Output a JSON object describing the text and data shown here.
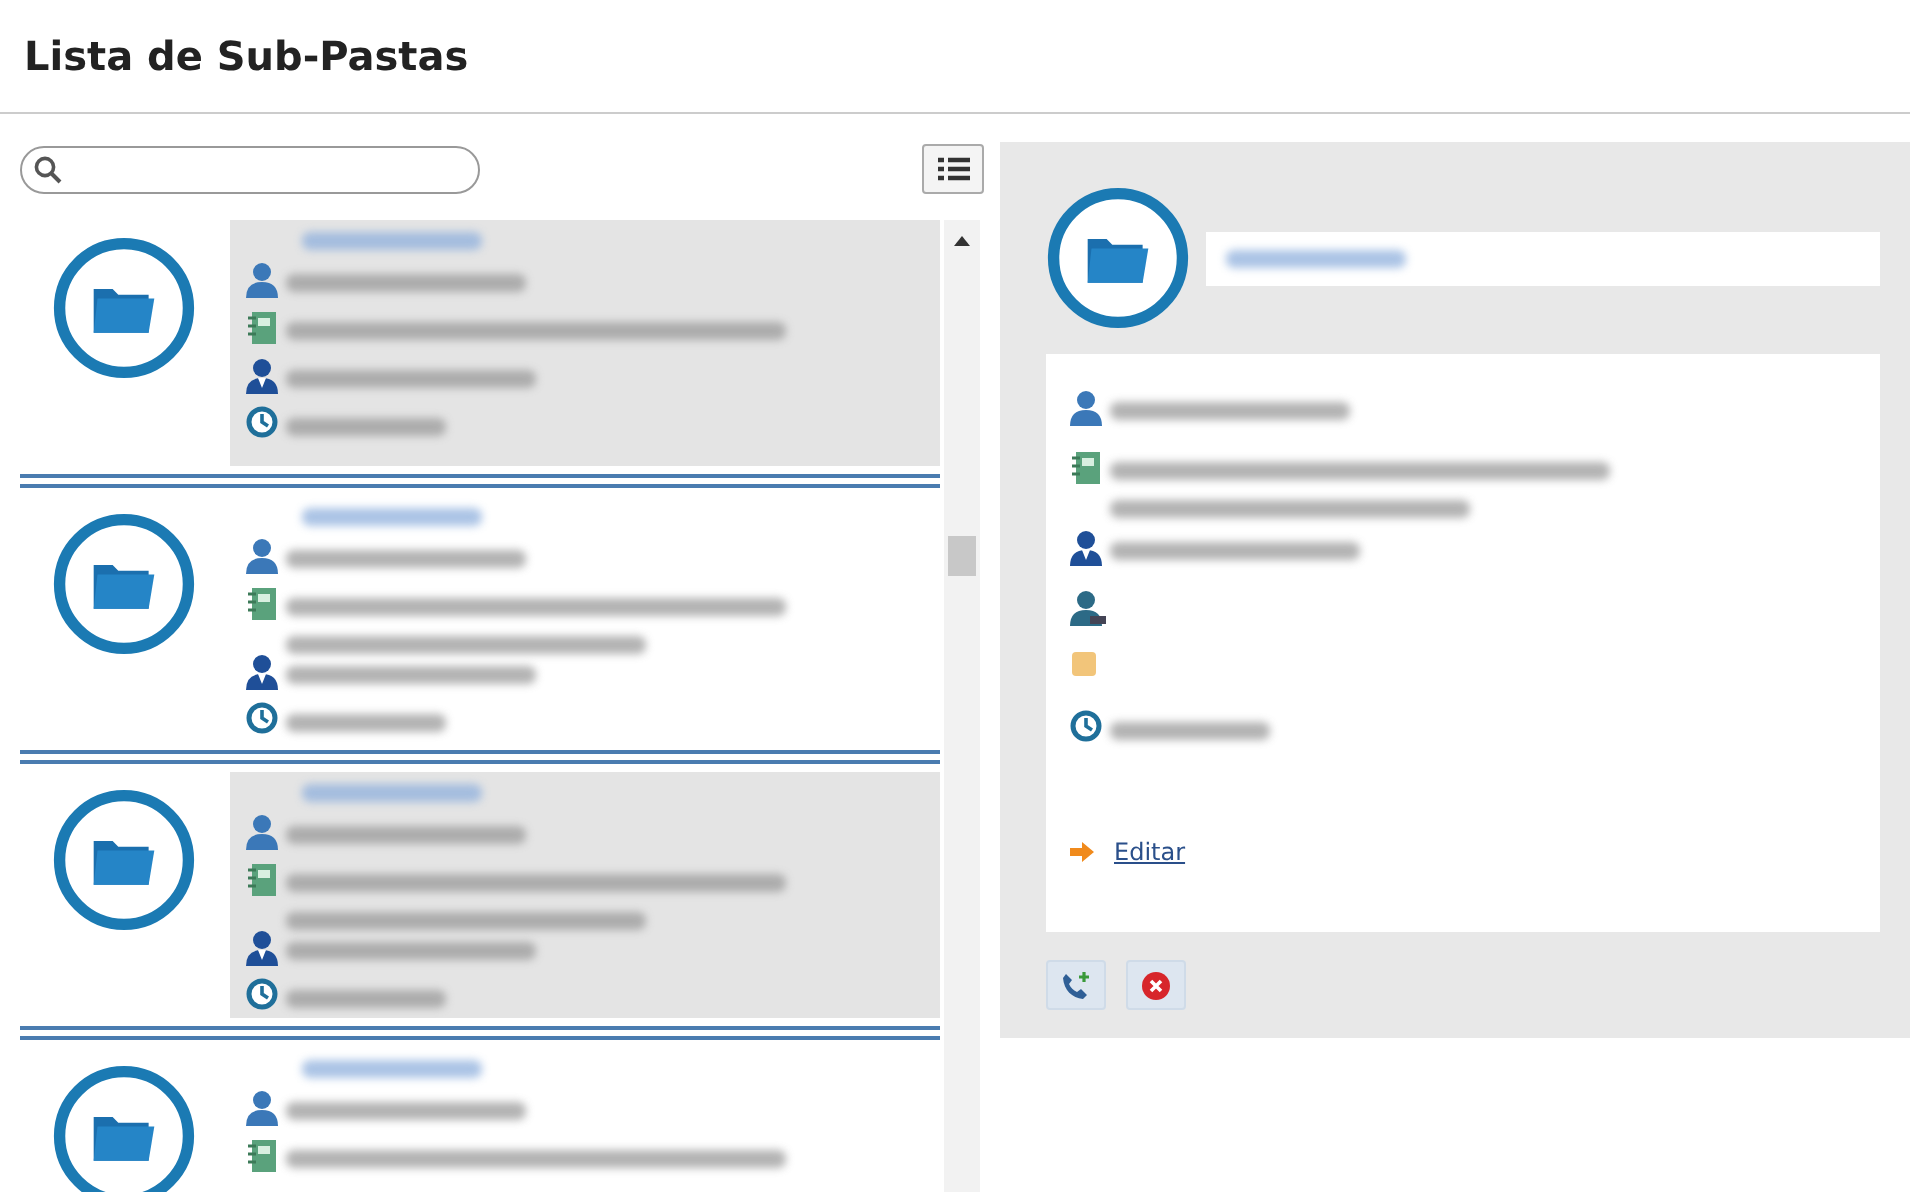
{
  "page": {
    "title": "Lista de Sub-Pastas"
  },
  "items": [
    {
      "selected": true,
      "rows": [
        {
          "kind": "owner"
        },
        {
          "kind": "notes"
        },
        {
          "kind": "manager"
        },
        {
          "kind": "time"
        }
      ]
    },
    {
      "selected": false,
      "rows": [
        {
          "kind": "owner"
        },
        {
          "kind": "notes",
          "wide": true
        },
        {
          "kind": "manager"
        },
        {
          "kind": "time"
        }
      ]
    },
    {
      "selected": true,
      "rows": [
        {
          "kind": "owner"
        },
        {
          "kind": "notes",
          "wide": true
        },
        {
          "kind": "manager"
        },
        {
          "kind": "time"
        }
      ]
    },
    {
      "selected": false,
      "rows": [
        {
          "kind": "owner"
        },
        {
          "kind": "notes"
        }
      ]
    }
  ],
  "detail": {
    "rows": [
      {
        "kind": "owner"
      },
      {
        "kind": "notes",
        "wide": true
      },
      {
        "kind": "manager"
      },
      {
        "kind": "agent"
      },
      {
        "kind": "tag"
      },
      {
        "kind": "time"
      }
    ],
    "link": "Editar",
    "buttons": [
      {
        "kind": "call"
      },
      {
        "kind": "delete"
      }
    ]
  }
}
